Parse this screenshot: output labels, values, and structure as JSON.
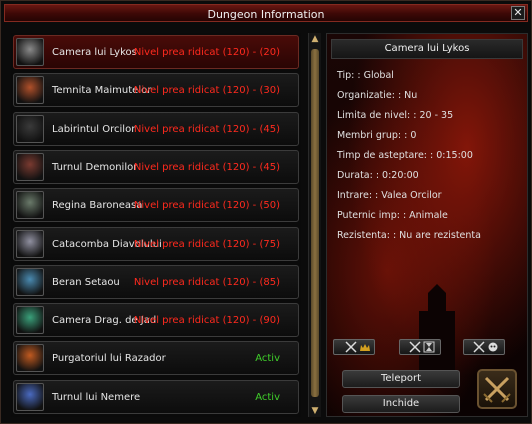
{
  "window": {
    "title": "Dungeon Information",
    "close_label": "✕"
  },
  "dungeons": [
    {
      "name": "Camera lui Lykos",
      "status": "Nivel prea ridicat (120) - (20)",
      "state": "locked",
      "icon": "lykos-portrait-icon",
      "color": "#8a8a8a"
    },
    {
      "name": "Temnita Maimutelor",
      "status": "Nivel prea ridicat (120) - (30)",
      "state": "locked",
      "icon": "ape-portrait-icon",
      "color": "#b0502a"
    },
    {
      "name": "Labirintul Orcilor",
      "status": "Nivel prea ridicat (120) - (45)",
      "state": "locked",
      "icon": "orc-portrait-icon",
      "color": "#3a3a3a"
    },
    {
      "name": "Turnul Demonilor",
      "status": "Nivel prea ridicat (120) - (45)",
      "state": "locked",
      "icon": "demon-portrait-icon",
      "color": "#7a3a30"
    },
    {
      "name": "Regina Baroneasa",
      "status": "Nivel prea ridicat (120) - (50)",
      "state": "locked",
      "icon": "spider-queen-portrait-icon",
      "color": "#6a7a6a"
    },
    {
      "name": "Catacomba Diavolului",
      "status": "Nivel prea ridicat (120) - (75)",
      "state": "locked",
      "icon": "devil-portrait-icon",
      "color": "#9090a0"
    },
    {
      "name": "Beran Setaou",
      "status": "Nivel prea ridicat (120) - (85)",
      "state": "locked",
      "icon": "dragon-portrait-icon",
      "color": "#4a8ab0"
    },
    {
      "name": "Camera Drag. de Jad",
      "status": "Nivel prea ridicat (120) - (90)",
      "state": "locked",
      "icon": "jade-dragon-portrait-icon",
      "color": "#3aa07a"
    },
    {
      "name": "Purgatoriul lui Razador",
      "status": "Activ",
      "state": "active",
      "icon": "razador-portrait-icon",
      "color": "#c05a20"
    },
    {
      "name": "Turnul lui Nemere",
      "status": "Activ",
      "state": "active",
      "icon": "nemere-portrait-icon",
      "color": "#4a6ac0"
    }
  ],
  "detail": {
    "header": "Camera lui Lykos",
    "lines": [
      "Tip: : Global",
      "Organizatie: : Nu",
      "Limita de nivel: : 20 - 35",
      "Membri grup: : 0",
      "Timp de asteptare: : 0:15:00",
      "Durata: : 0:20:00",
      "Intrare: : Valea Orcilor",
      "Puternic imp: : Animale",
      "Rezistenta: : Nu are rezistenta"
    ],
    "teleport_label": "Teleport",
    "close_label": "Inchide"
  },
  "scroll": {
    "up": "▲",
    "down": "▼"
  },
  "colors": {
    "locked": "#ff2a1e",
    "active": "#3fcf2a",
    "title_bar": "#5a100c"
  }
}
